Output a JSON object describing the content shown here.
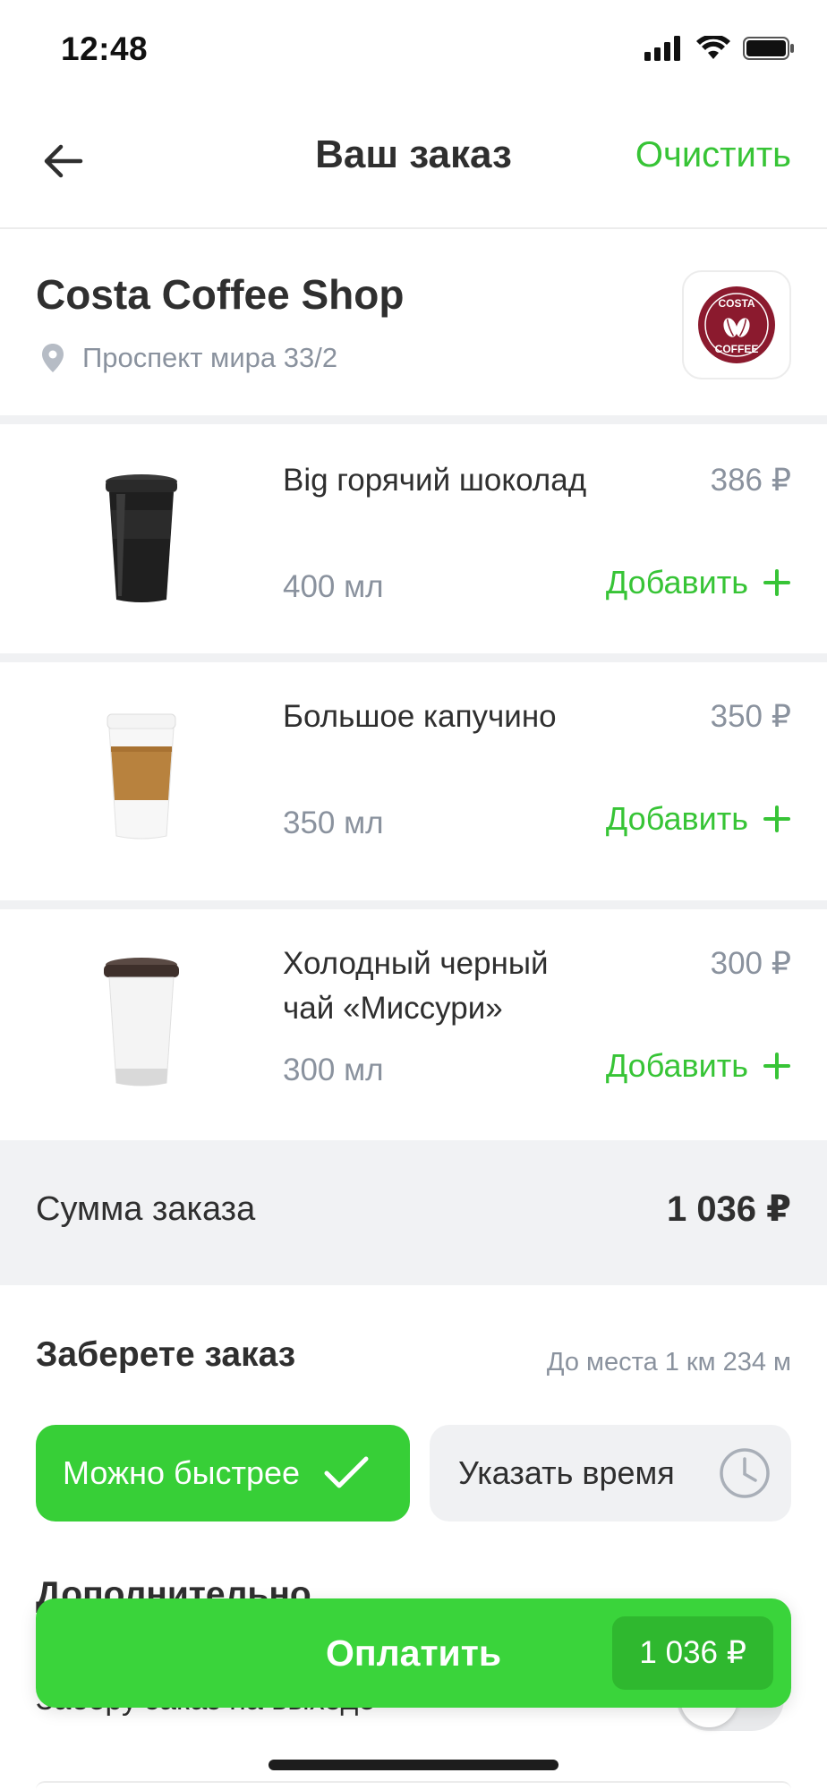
{
  "status_bar": {
    "time": "12:48"
  },
  "header": {
    "title": "Ваш заказ",
    "clear_label": "Очистить"
  },
  "shop": {
    "name": "Costa Coffee Shop",
    "address": "Проспект мира 33/2",
    "logo_text_top": "COSTA",
    "logo_text_bottom": "COFFEE"
  },
  "items": [
    {
      "name": "Big горячий шоколад",
      "price": "386 ₽",
      "volume": "400 мл",
      "add_label": "Добавить",
      "image": "black-cup"
    },
    {
      "name": "Большое капучино",
      "price": "350 ₽",
      "volume": "350 мл",
      "add_label": "Добавить",
      "image": "sleeve-cup"
    },
    {
      "name": "Холодный черный чай «Миссури»",
      "price": "300 ₽",
      "volume": "300 мл",
      "add_label": "Добавить",
      "image": "white-cup"
    }
  ],
  "summary": {
    "label": "Сумма заказа",
    "value": "1 036 ₽"
  },
  "pickup": {
    "title": "Заберете заказ",
    "distance": "До места 1 км 234 м",
    "fast_label": "Можно быстрее",
    "time_label": "Указать время"
  },
  "extra": {
    "title": "Дополнительно",
    "row_label": "Заберу заказ на выходе"
  },
  "pay": {
    "label": "Оплатить",
    "amount": "1 036 ₽"
  },
  "colors": {
    "accent": "#37c436",
    "muted": "#8a929e",
    "surface": "#f1f2f4"
  }
}
